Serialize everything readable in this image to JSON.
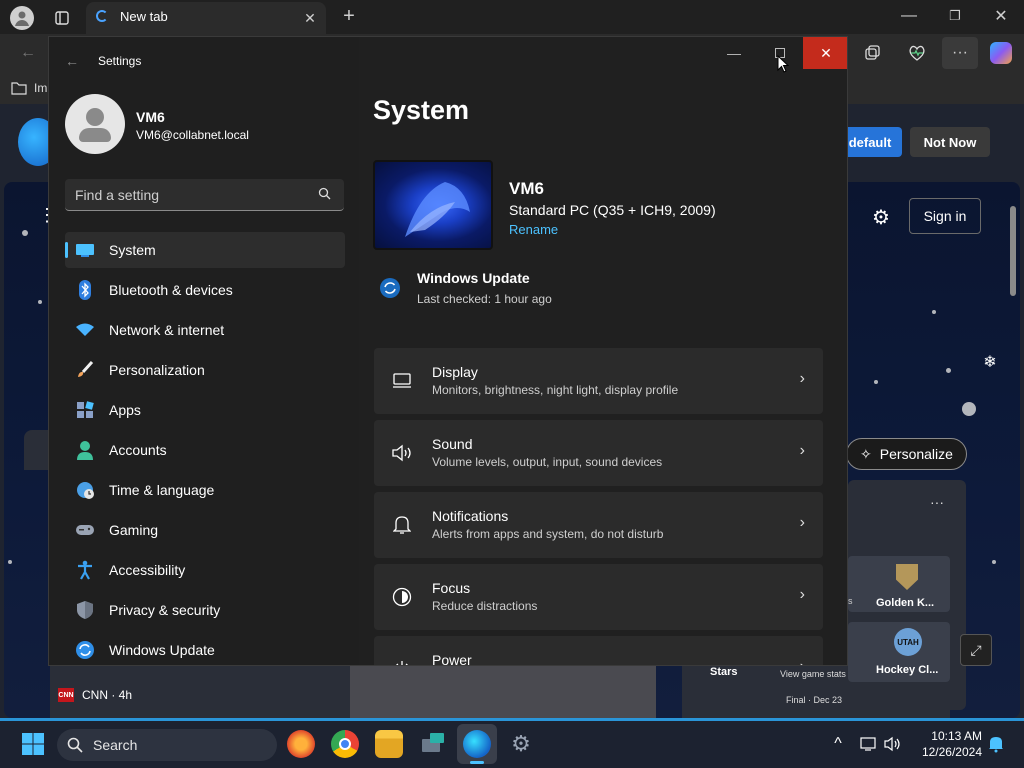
{
  "browser": {
    "tab_title": "New tab",
    "favorites_item": "Im",
    "default_button": "default",
    "not_now_button": "Not Now",
    "sign_in": "Sign in",
    "personalize": "Personalize",
    "news_source": "CNN · 4h",
    "news_source_badge": "CNN",
    "sports": {
      "team1": "Golden K...",
      "team2": "Hockey Cl...",
      "stars": "Stars",
      "view_stats": "View game stats",
      "final": "Final · Dec 23",
      "stats_label": "s",
      "utah_badge": "UTAH"
    }
  },
  "settings": {
    "window_title": "Settings",
    "user": {
      "name": "VM6",
      "email": "VM6@collabnet.local"
    },
    "search_placeholder": "Find a setting",
    "nav": [
      {
        "label": "System",
        "icon": "monitor-icon",
        "color": "#4cc2ff"
      },
      {
        "label": "Bluetooth & devices",
        "icon": "bluetooth-icon",
        "color": "#2f7fe0"
      },
      {
        "label": "Network & internet",
        "icon": "wifi-icon",
        "color": "#49b3ff"
      },
      {
        "label": "Personalization",
        "icon": "brush-icon",
        "color": "#f3a35b"
      },
      {
        "label": "Apps",
        "icon": "apps-icon",
        "color": "#8aa0c8"
      },
      {
        "label": "Accounts",
        "icon": "person-icon",
        "color": "#3fc19b"
      },
      {
        "label": "Time & language",
        "icon": "globe-icon",
        "color": "#4a9fe6"
      },
      {
        "label": "Gaming",
        "icon": "gamepad-icon",
        "color": "#9aa4b4"
      },
      {
        "label": "Accessibility",
        "icon": "accessibility-icon",
        "color": "#3aa0f0"
      },
      {
        "label": "Privacy & security",
        "icon": "shield-icon",
        "color": "#8c96a6"
      },
      {
        "label": "Windows Update",
        "icon": "update-icon",
        "color": "#2f8fe8"
      }
    ],
    "page_title": "System",
    "device": {
      "name": "VM6",
      "model": "Standard PC (Q35 + ICH9, 2009)",
      "rename": "Rename"
    },
    "update": {
      "title": "Windows Update",
      "subtitle": "Last checked: 1 hour ago"
    },
    "cards": [
      {
        "title": "Display",
        "subtitle": "Monitors, brightness, night light, display profile",
        "icon": "display-icon"
      },
      {
        "title": "Sound",
        "subtitle": "Volume levels, output, input, sound devices",
        "icon": "speaker-icon"
      },
      {
        "title": "Notifications",
        "subtitle": "Alerts from apps and system, do not disturb",
        "icon": "bell-icon"
      },
      {
        "title": "Focus",
        "subtitle": "Reduce distractions",
        "icon": "focus-icon"
      },
      {
        "title": "Power",
        "subtitle": "",
        "icon": "power-icon"
      }
    ]
  },
  "taskbar": {
    "search_label": "Search",
    "time": "10:13 AM",
    "date": "12/26/2024"
  },
  "colors": {
    "accent": "#4cc2ff",
    "close": "#c42b1c",
    "edge_blue": "#2674d9"
  }
}
